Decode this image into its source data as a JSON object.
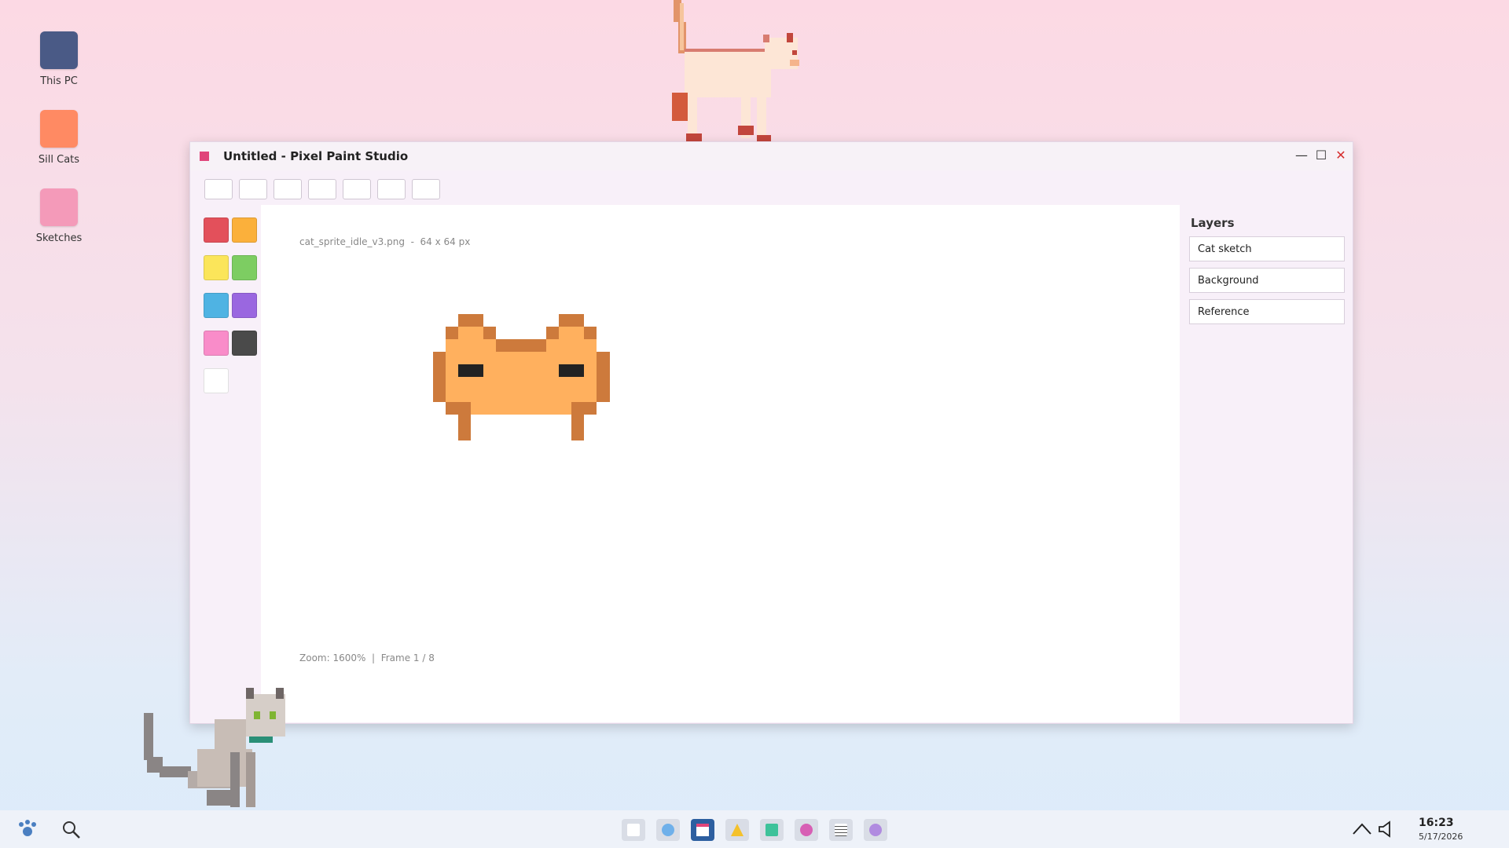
{
  "desktop": {
    "icons": [
      {
        "label": "This PC",
        "color": "#4a5a86"
      },
      {
        "label": "Sill Cats",
        "color": "#ff8a63"
      },
      {
        "label": "Sketches",
        "color": "#f49ab9"
      }
    ]
  },
  "window": {
    "title": "Untitled - Pixel Paint Studio",
    "accent": "#e0457a",
    "controls": {
      "minimize": "—",
      "maximize": "☐",
      "close": "✕"
    },
    "canvas_info": "cat_sprite_idle_v3.png  -  64 x 64 px",
    "status": "Zoom: 1600%  |  Frame 1 / 8"
  },
  "palette": [
    "#e3505b",
    "#fbb03b",
    "#fbe55a",
    "#7dcd62",
    "#4fb3e3",
    "#9a67e0",
    "#f98cc9",
    "#4a4a4a",
    "#ffffff"
  ],
  "layers": {
    "title": "Layers",
    "items": [
      "Cat sketch",
      "Background",
      "Reference"
    ]
  },
  "taskbar": {
    "apps": [
      "window",
      "circle",
      "calendar",
      "triangle",
      "square",
      "pink-circle",
      "notes",
      "purple-circle"
    ],
    "time": "16:23",
    "date": "5/17/2026"
  }
}
